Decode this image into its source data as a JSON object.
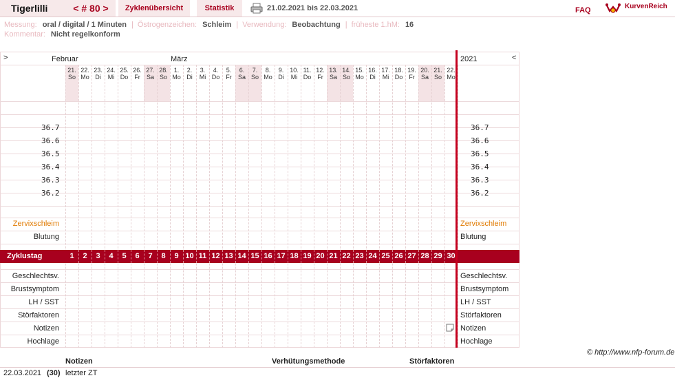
{
  "header": {
    "user": "Tigerlilli",
    "cycle_nav": "< # 80 >",
    "tabs": [
      "Zyklenübersicht",
      "Statistik"
    ],
    "date_range": "21.02.2021 bis 22.03.2021",
    "faq": "FAQ",
    "brand": "KurvenReich"
  },
  "info": {
    "line1": [
      {
        "label": "Messung:",
        "value": "oral / digital / 1 Minuten"
      },
      {
        "label": "Östrogenzeichen:",
        "value": "Schleim"
      },
      {
        "label": "Verwendung:",
        "value": "Beobachtung"
      },
      {
        "label": "früheste 1.hM:",
        "value": "16"
      }
    ],
    "line2": {
      "label": "Kommentar:",
      "value": "Nicht regelkonform"
    }
  },
  "chart": {
    "nav_prev": ">",
    "nav_next": "<",
    "months": [
      "Februar",
      "März"
    ],
    "year": "2021",
    "days": [
      {
        "d": "21.",
        "w": "So"
      },
      {
        "d": "22.",
        "w": "Mo"
      },
      {
        "d": "23.",
        "w": "Di"
      },
      {
        "d": "24.",
        "w": "Mi"
      },
      {
        "d": "25.",
        "w": "Do"
      },
      {
        "d": "26.",
        "w": "Fr"
      },
      {
        "d": "27.",
        "w": "Sa"
      },
      {
        "d": "28.",
        "w": "So"
      },
      {
        "d": "1.",
        "w": "Mo"
      },
      {
        "d": "2.",
        "w": "Di"
      },
      {
        "d": "3.",
        "w": "Mi"
      },
      {
        "d": "4.",
        "w": "Do"
      },
      {
        "d": "5.",
        "w": "Fr"
      },
      {
        "d": "6.",
        "w": "Sa"
      },
      {
        "d": "7.",
        "w": "So"
      },
      {
        "d": "8.",
        "w": "Mo"
      },
      {
        "d": "9.",
        "w": "Di"
      },
      {
        "d": "10.",
        "w": "Mi"
      },
      {
        "d": "11.",
        "w": "Do"
      },
      {
        "d": "12.",
        "w": "Fr"
      },
      {
        "d": "13.",
        "w": "Sa"
      },
      {
        "d": "14.",
        "w": "So"
      },
      {
        "d": "15.",
        "w": "Mo"
      },
      {
        "d": "16.",
        "w": "Di"
      },
      {
        "d": "17.",
        "w": "Mi"
      },
      {
        "d": "18.",
        "w": "Do"
      },
      {
        "d": "19.",
        "w": "Fr"
      },
      {
        "d": "20.",
        "w": "Sa"
      },
      {
        "d": "21.",
        "w": "So"
      },
      {
        "d": "22.",
        "w": "Mo"
      }
    ],
    "temps": [
      "36.7",
      "36.6",
      "36.5",
      "36.4",
      "36.3",
      "36.2"
    ],
    "rows_top": [
      "Zervixschleim",
      "Blutung"
    ],
    "zyklustag_label": "Zyklustag",
    "cycle_days": [
      "1",
      "2",
      "3",
      "4",
      "5",
      "6",
      "7",
      "8",
      "9",
      "10",
      "11",
      "12",
      "13",
      "14",
      "15",
      "16",
      "17",
      "18",
      "19",
      "20",
      "21",
      "22",
      "23",
      "24",
      "25",
      "26",
      "27",
      "28",
      "29",
      "30"
    ],
    "rows_bottom": [
      "Geschlechtsv.",
      "Brustsymptom",
      "LH / SST",
      "Störfaktoren",
      "Notizen",
      "Hochlage"
    ],
    "colors": {
      "accent": "#a8001e",
      "zervix": "#e07a00",
      "weekend": "#f4e3e5"
    }
  },
  "copyright": "© http://www.nfp-forum.de",
  "bottom": {
    "headers": [
      "Notizen",
      "Verhütungsmethode",
      "Störfaktoren"
    ],
    "rows": [
      {
        "date": "22.03.2021",
        "day": "(30)",
        "note": "letzter ZT"
      }
    ]
  }
}
